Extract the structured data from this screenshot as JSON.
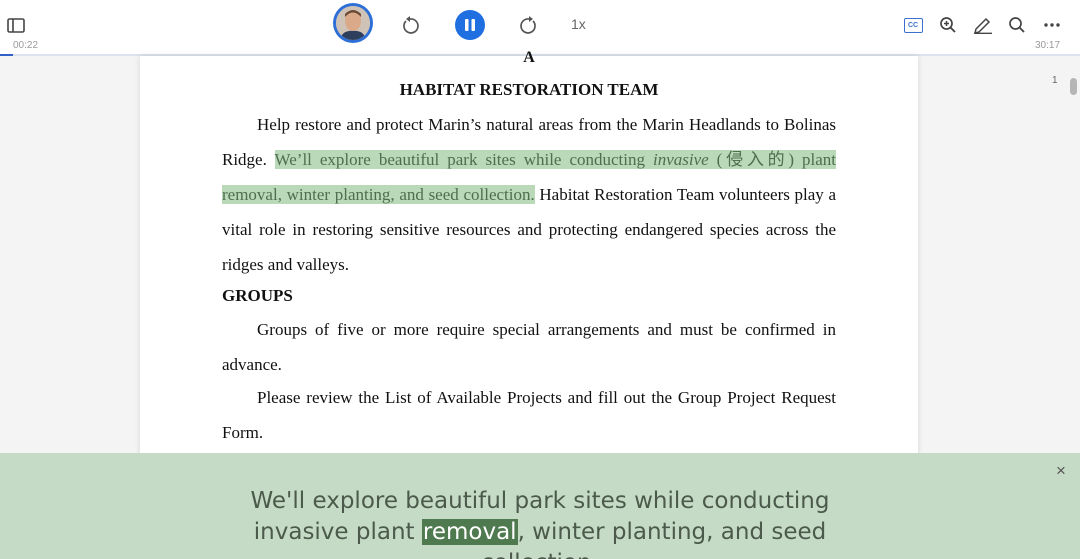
{
  "player": {
    "elapsed": "00:22",
    "duration": "30:17",
    "speed": "1x",
    "progress_fraction": 0.012,
    "accent_color": "#1f6fe0"
  },
  "toolbar_icons": {
    "left": [
      "sidebar-toggle-icon"
    ],
    "center": [
      "avatar",
      "rewind-icon",
      "pause-icon",
      "forward-icon"
    ],
    "right": [
      "closed-captions-icon",
      "zoom-in-icon",
      "annotate-icon",
      "search-icon",
      "more-icon"
    ]
  },
  "cc_label": "CC",
  "document": {
    "letter": "A",
    "title": "HABITAT RESTORATION TEAM",
    "p1_start": "Help restore and protect Marin’s natural areas from the Marin Headlands to Bolinas Ridge. ",
    "p1_hl_a": "We’ll explore beautiful park sites while conducting ",
    "p1_hl_italic": "invasive",
    "p1_hl_b": " (侵入的) plant removal, winter planting, and seed collection.",
    "p1_end": " Habitat Restoration Team volunteers play a vital role in restoring sensitive resources and protecting endangered species across the ridges and valleys.",
    "groups_heading": "GROUPS",
    "p2": "Groups of five or more require special arrangements and must be confirmed in advance.",
    "p3": "Please review the List of Available Projects and fill out the Group Project Request Form.",
    "page_number": "1"
  },
  "caption": {
    "before": "We'll explore beautiful park sites while conducting invasive plant ",
    "current": "removal",
    "after": ", winter planting, and seed collection.",
    "close_symbol": "×",
    "background": "#c6dbc6"
  }
}
